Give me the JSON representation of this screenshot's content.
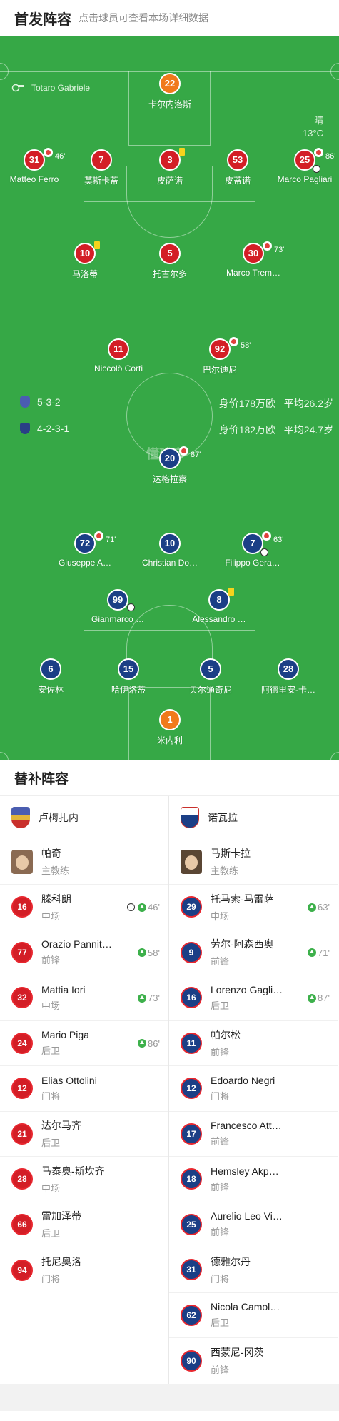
{
  "header": {
    "title": "首发阵容",
    "hint": "点击球员可查看本场详细数据"
  },
  "referee": "Totaro Gabriele",
  "weather": {
    "condition": "晴",
    "temp": "13°C"
  },
  "watermark": "懂球帝",
  "colors": {
    "pitch": "#36a846",
    "home": "#d31e26",
    "away": "#1b3f86",
    "gk_home": "#f07a1b",
    "sub_up": "#3db04b"
  },
  "home_lineup": [
    {
      "num": "22",
      "name": "卡尔内洛斯"
    },
    {
      "num": "31",
      "name": "Matteo Ferro",
      "sub": "46'"
    },
    {
      "num": "7",
      "name": "莫斯卡蒂"
    },
    {
      "num": "3",
      "name": "皮萨诺"
    },
    {
      "num": "53",
      "name": "皮蒂诺"
    },
    {
      "num": "25",
      "name": "Marco Pagliari",
      "sub": "86'"
    },
    {
      "num": "10",
      "name": "马洛蒂"
    },
    {
      "num": "5",
      "name": "托古尔多"
    },
    {
      "num": "30",
      "name": "Marco Trem…",
      "sub": "73'"
    },
    {
      "num": "11",
      "name": "Niccolò Corti"
    },
    {
      "num": "92",
      "name": "巴尔迪尼",
      "sub": "58'"
    }
  ],
  "away_lineup": [
    {
      "num": "20",
      "name": "达格拉察",
      "sub": "87'"
    },
    {
      "num": "72",
      "name": "Giuseppe A…",
      "sub": "71'"
    },
    {
      "num": "10",
      "name": "Christian Do…"
    },
    {
      "num": "7",
      "name": "Filippo Gera…",
      "sub": "63'"
    },
    {
      "num": "99",
      "name": "Gianmarco …"
    },
    {
      "num": "8",
      "name": "Alessandro …"
    },
    {
      "num": "6",
      "name": "安佐林"
    },
    {
      "num": "15",
      "name": "哈伊洛蒂"
    },
    {
      "num": "5",
      "name": "贝尔通奇尼"
    },
    {
      "num": "28",
      "name": "阿德里安-卡…"
    },
    {
      "num": "1",
      "name": "米内利"
    }
  ],
  "home_info": {
    "formation": "5-3-2",
    "value": "身价178万欧",
    "age": "平均26.2岁"
  },
  "away_info": {
    "formation": "4-2-3-1",
    "value": "身价182万欧",
    "age": "平均24.7岁"
  },
  "subs_title": "替补阵容",
  "home_team": {
    "name": "卢梅扎内",
    "coach": "帕奇",
    "coach_role": "主教练"
  },
  "away_team": {
    "name": "诺瓦拉",
    "coach": "马斯卡拉",
    "coach_role": "主教练"
  },
  "home_subs": [
    {
      "num": "16",
      "name": "滕科朗",
      "pos": "中场",
      "in": "46'"
    },
    {
      "num": "77",
      "name": "Orazio Pannit…",
      "pos": "前锋",
      "in": "58'"
    },
    {
      "num": "32",
      "name": "Mattia Iori",
      "pos": "中场",
      "in": "73'"
    },
    {
      "num": "24",
      "name": "Mario Piga",
      "pos": "后卫",
      "in": "86'"
    },
    {
      "num": "12",
      "name": "Elias Ottolini",
      "pos": "门将"
    },
    {
      "num": "21",
      "name": "达尔马齐",
      "pos": "后卫"
    },
    {
      "num": "28",
      "name": "马泰奥-斯坎齐",
      "pos": "中场"
    },
    {
      "num": "66",
      "name": "雷加泽蒂",
      "pos": "后卫"
    },
    {
      "num": "94",
      "name": "托尼奥洛",
      "pos": "门将"
    }
  ],
  "away_subs": [
    {
      "num": "29",
      "name": "托马索-马雷萨",
      "pos": "中场",
      "in": "63'"
    },
    {
      "num": "9",
      "name": "劳尔-阿森西奥",
      "pos": "前锋",
      "in": "71'"
    },
    {
      "num": "16",
      "name": "Lorenzo Gagli…",
      "pos": "后卫",
      "in": "87'"
    },
    {
      "num": "11",
      "name": "帕尔松",
      "pos": "前锋"
    },
    {
      "num": "12",
      "name": "Edoardo Negri",
      "pos": "门将"
    },
    {
      "num": "17",
      "name": "Francesco Att…",
      "pos": "前锋"
    },
    {
      "num": "18",
      "name": "Hemsley Akp…",
      "pos": "前锋"
    },
    {
      "num": "25",
      "name": "Aurelio Leo Vi…",
      "pos": "前锋"
    },
    {
      "num": "31",
      "name": "德雅尔丹",
      "pos": "门将"
    },
    {
      "num": "62",
      "name": "Nicola Camol…",
      "pos": "后卫"
    },
    {
      "num": "90",
      "name": "西蒙尼-冈茨",
      "pos": "前锋"
    }
  ]
}
